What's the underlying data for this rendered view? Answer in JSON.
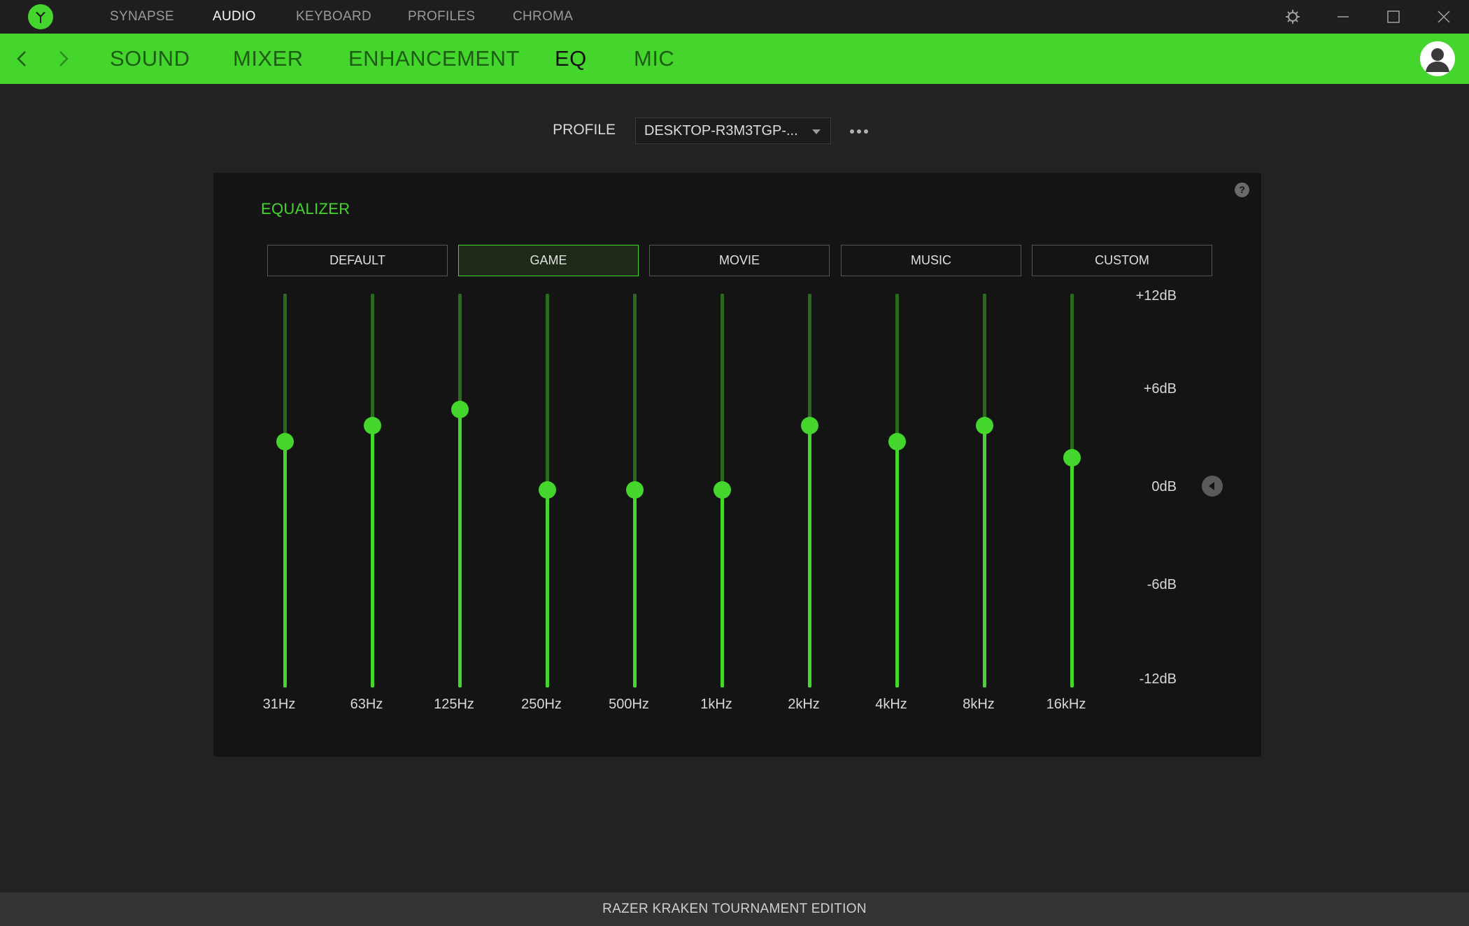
{
  "top_nav": {
    "items": [
      {
        "label": "SYNAPSE",
        "active": false
      },
      {
        "label": "AUDIO",
        "active": true
      },
      {
        "label": "KEYBOARD",
        "active": false
      },
      {
        "label": "PROFILES",
        "active": false
      },
      {
        "label": "CHROMA",
        "active": false
      }
    ]
  },
  "window_controls": [
    "settings-icon",
    "minimize-icon",
    "maximize-icon",
    "close-icon"
  ],
  "sub_nav": {
    "items": [
      {
        "label": "SOUND",
        "active": false
      },
      {
        "label": "MIXER",
        "active": false
      },
      {
        "label": "ENHANCEMENT",
        "active": false
      },
      {
        "label": "EQ",
        "active": true
      },
      {
        "label": "MIC",
        "active": false
      }
    ]
  },
  "profile": {
    "label": "PROFILE",
    "value": "DESKTOP-R3M3TGP-...",
    "more_icon": "ellipsis-icon"
  },
  "equalizer": {
    "title": "EQUALIZER",
    "help": "?",
    "presets": [
      {
        "label": "DEFAULT",
        "active": false
      },
      {
        "label": "GAME",
        "active": true
      },
      {
        "label": "MOVIE",
        "active": false
      },
      {
        "label": "MUSIC",
        "active": false
      },
      {
        "label": "CUSTOM",
        "active": false
      }
    ],
    "db_scale": [
      "+12dB",
      "+6dB",
      "0dB",
      "-6dB",
      "-12dB"
    ],
    "db_range": [
      -12,
      12
    ],
    "bands": [
      {
        "freq": "31Hz",
        "gain_db": 3
      },
      {
        "freq": "63Hz",
        "gain_db": 4
      },
      {
        "freq": "125Hz",
        "gain_db": 5
      },
      {
        "freq": "250Hz",
        "gain_db": 0
      },
      {
        "freq": "500Hz",
        "gain_db": 0
      },
      {
        "freq": "1kHz",
        "gain_db": 0
      },
      {
        "freq": "2kHz",
        "gain_db": 4
      },
      {
        "freq": "4kHz",
        "gain_db": 3
      },
      {
        "freq": "8kHz",
        "gain_db": 4
      },
      {
        "freq": "16kHz",
        "gain_db": 2
      }
    ]
  },
  "footer": {
    "device": "RAZER KRAKEN TOURNAMENT EDITION"
  },
  "colors": {
    "accent": "#44d62c",
    "background": "#222222",
    "panel": "#141414"
  }
}
